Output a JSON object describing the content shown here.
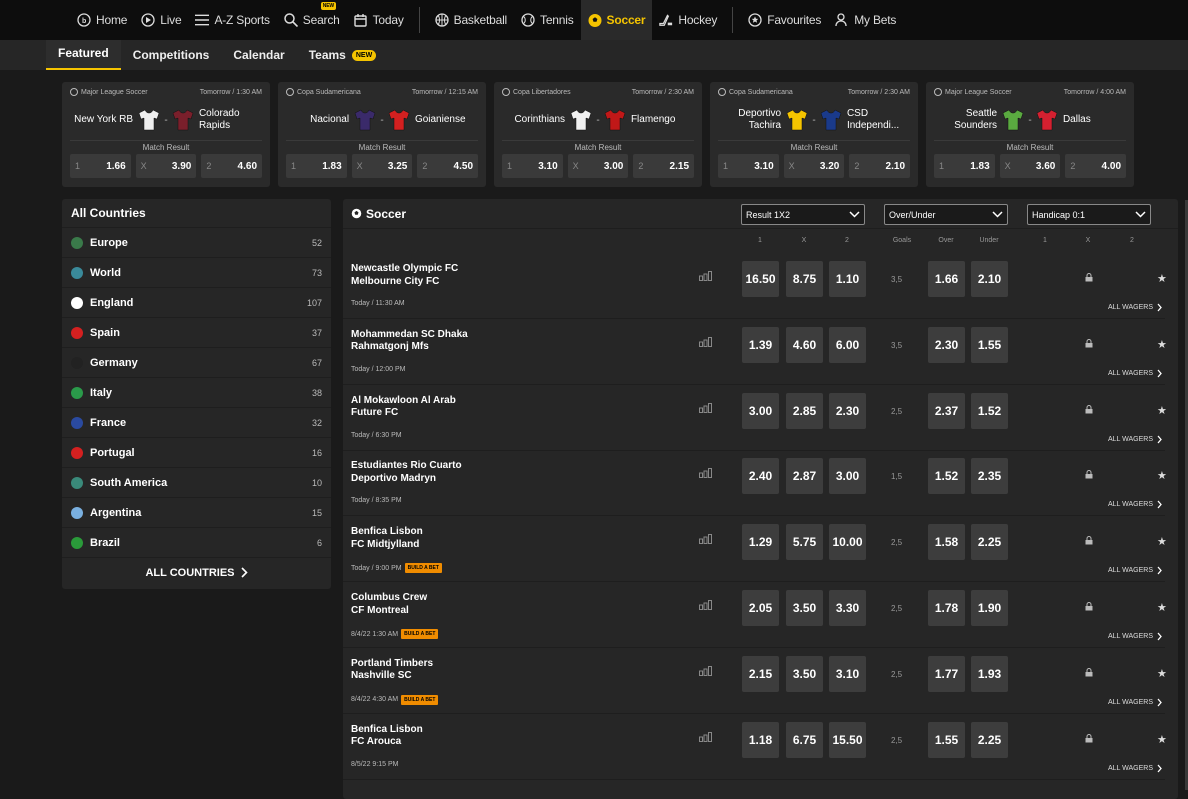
{
  "nav": {
    "items": [
      {
        "label": "Home",
        "icon": "home-icon"
      },
      {
        "label": "Live",
        "icon": "live-icon"
      },
      {
        "label": "A-Z Sports",
        "icon": "menu-icon"
      },
      {
        "label": "Search",
        "icon": "search-icon",
        "badge": "NEW"
      },
      {
        "label": "Today",
        "icon": "calendar-icon"
      },
      {
        "label": "Basketball",
        "icon": "basketball-icon"
      },
      {
        "label": "Tennis",
        "icon": "tennis-icon"
      },
      {
        "label": "Soccer",
        "icon": "soccer-icon",
        "active": true
      },
      {
        "label": "Hockey",
        "icon": "hockey-icon"
      },
      {
        "label": "Favourites",
        "icon": "star-icon"
      },
      {
        "label": "My Bets",
        "icon": "bets-icon"
      }
    ]
  },
  "subnav": {
    "tabs": [
      "Featured",
      "Competitions",
      "Calendar",
      "Teams"
    ],
    "teams_badge": "NEW"
  },
  "featured": [
    {
      "league": "Major League Soccer",
      "time": "Tomorrow / 1:30 AM",
      "home": "New York RB",
      "away": "Colorado Rapids",
      "home_color": "#eeeeee",
      "away_color": "#7a1f2b",
      "market": "Match Result",
      "odds": [
        [
          "1",
          "1.66"
        ],
        [
          "X",
          "3.90"
        ],
        [
          "2",
          "4.60"
        ]
      ]
    },
    {
      "league": "Copa Sudamericana",
      "time": "Tomorrow / 12:15 AM",
      "home": "Nacional",
      "away": "Goianiense",
      "home_color": "#3a2a6a",
      "away_color": "#d42020",
      "market": "Match Result",
      "odds": [
        [
          "1",
          "1.83"
        ],
        [
          "X",
          "3.25"
        ],
        [
          "2",
          "4.50"
        ]
      ]
    },
    {
      "league": "Copa Libertadores",
      "time": "Tomorrow / 2:30 AM",
      "home": "Corinthians",
      "away": "Flamengo",
      "home_color": "#f0f0f0",
      "away_color": "#c01818",
      "market": "Match Result",
      "odds": [
        [
          "1",
          "3.10"
        ],
        [
          "X",
          "3.00"
        ],
        [
          "2",
          "2.15"
        ]
      ]
    },
    {
      "league": "Copa Sudamericana",
      "time": "Tomorrow / 2:30 AM",
      "home": "Deportivo Tachira",
      "away": "CSD Independi...",
      "home_color": "#f5c400",
      "away_color": "#1a3a8a",
      "market": "Match Result",
      "odds": [
        [
          "1",
          "3.10"
        ],
        [
          "X",
          "3.20"
        ],
        [
          "2",
          "2.10"
        ]
      ]
    },
    {
      "league": "Major League Soccer",
      "time": "Tomorrow / 4:00 AM",
      "home": "Seattle Sounders",
      "away": "Dallas",
      "home_color": "#5aaa40",
      "away_color": "#d42030",
      "market": "Match Result",
      "odds": [
        [
          "1",
          "1.83"
        ],
        [
          "X",
          "3.60"
        ],
        [
          "2",
          "4.00"
        ]
      ]
    }
  ],
  "countries": {
    "title": "All Countries",
    "items": [
      {
        "name": "Europe",
        "count": "52",
        "color": "#3a7a4a"
      },
      {
        "name": "World",
        "count": "73",
        "color": "#3a8a9a"
      },
      {
        "name": "England",
        "count": "107",
        "color": "#ffffff"
      },
      {
        "name": "Spain",
        "count": "37",
        "color": "#d42020"
      },
      {
        "name": "Germany",
        "count": "67",
        "color": "#222222"
      },
      {
        "name": "Italy",
        "count": "38",
        "color": "#2a9a4a"
      },
      {
        "name": "France",
        "count": "32",
        "color": "#2a4aa0"
      },
      {
        "name": "Portugal",
        "count": "16",
        "color": "#d42020"
      },
      {
        "name": "South America",
        "count": "10",
        "color": "#3a8a7a"
      },
      {
        "name": "Argentina",
        "count": "15",
        "color": "#7ab0e0"
      },
      {
        "name": "Brazil",
        "count": "6",
        "color": "#2a9a3a"
      }
    ],
    "all": "ALL COUNTRIES"
  },
  "main": {
    "title": "Soccer",
    "dropdowns": [
      "Result 1X2",
      "Over/Under",
      "Handicap 0:1"
    ],
    "col_headers": {
      "r1": "1",
      "rx": "X",
      "r2": "2",
      "goals": "Goals",
      "over": "Over",
      "under": "Under",
      "h1": "1",
      "hx": "X",
      "h2": "2"
    },
    "all_wagers": "ALL WAGERS",
    "build_a_bet": "BUILD A BET",
    "matches": [
      {
        "home": "Newcastle Olympic FC",
        "away": "Melbourne City FC",
        "time": "Today / 11:30 AM",
        "odds": [
          "16.50",
          "8.75",
          "1.10"
        ],
        "goals": "3,5",
        "over": "1.66",
        "under": "2.10",
        "bab": false
      },
      {
        "home": "Mohammedan SC Dhaka",
        "away": "Rahmatgonj Mfs",
        "time": "Today / 12:00 PM",
        "odds": [
          "1.39",
          "4.60",
          "6.00"
        ],
        "goals": "3,5",
        "over": "2.30",
        "under": "1.55",
        "bab": false
      },
      {
        "home": "Al Mokawloon Al Arab",
        "away": "Future FC",
        "time": "Today / 6:30 PM",
        "odds": [
          "3.00",
          "2.85",
          "2.30"
        ],
        "goals": "2,5",
        "over": "2.37",
        "under": "1.52",
        "bab": false
      },
      {
        "home": "Estudiantes Rio Cuarto",
        "away": "Deportivo Madryn",
        "time": "Today / 8:35 PM",
        "odds": [
          "2.40",
          "2.87",
          "3.00"
        ],
        "goals": "1,5",
        "over": "1.52",
        "under": "2.35",
        "bab": false
      },
      {
        "home": "Benfica Lisbon",
        "away": "FC Midtjylland",
        "time": "Today / 9:00 PM",
        "odds": [
          "1.29",
          "5.75",
          "10.00"
        ],
        "goals": "2,5",
        "over": "1.58",
        "under": "2.25",
        "bab": true
      },
      {
        "home": "Columbus Crew",
        "away": "CF Montreal",
        "time": "8/4/22 1:30 AM",
        "odds": [
          "2.05",
          "3.50",
          "3.30"
        ],
        "goals": "2,5",
        "over": "1.78",
        "under": "1.90",
        "bab": true
      },
      {
        "home": "Portland Timbers",
        "away": "Nashville SC",
        "time": "8/4/22 4:30 AM",
        "odds": [
          "2.15",
          "3.50",
          "3.10"
        ],
        "goals": "2,5",
        "over": "1.77",
        "under": "1.93",
        "bab": true
      },
      {
        "home": "Benfica Lisbon",
        "away": "FC Arouca",
        "time": "8/5/22 9:15 PM",
        "odds": [
          "1.18",
          "6.75",
          "15.50"
        ],
        "goals": "2,5",
        "over": "1.55",
        "under": "2.25",
        "bab": false
      }
    ]
  },
  "colors": {
    "accent": "#f5c400",
    "build_a_bet": "#f08c00"
  }
}
